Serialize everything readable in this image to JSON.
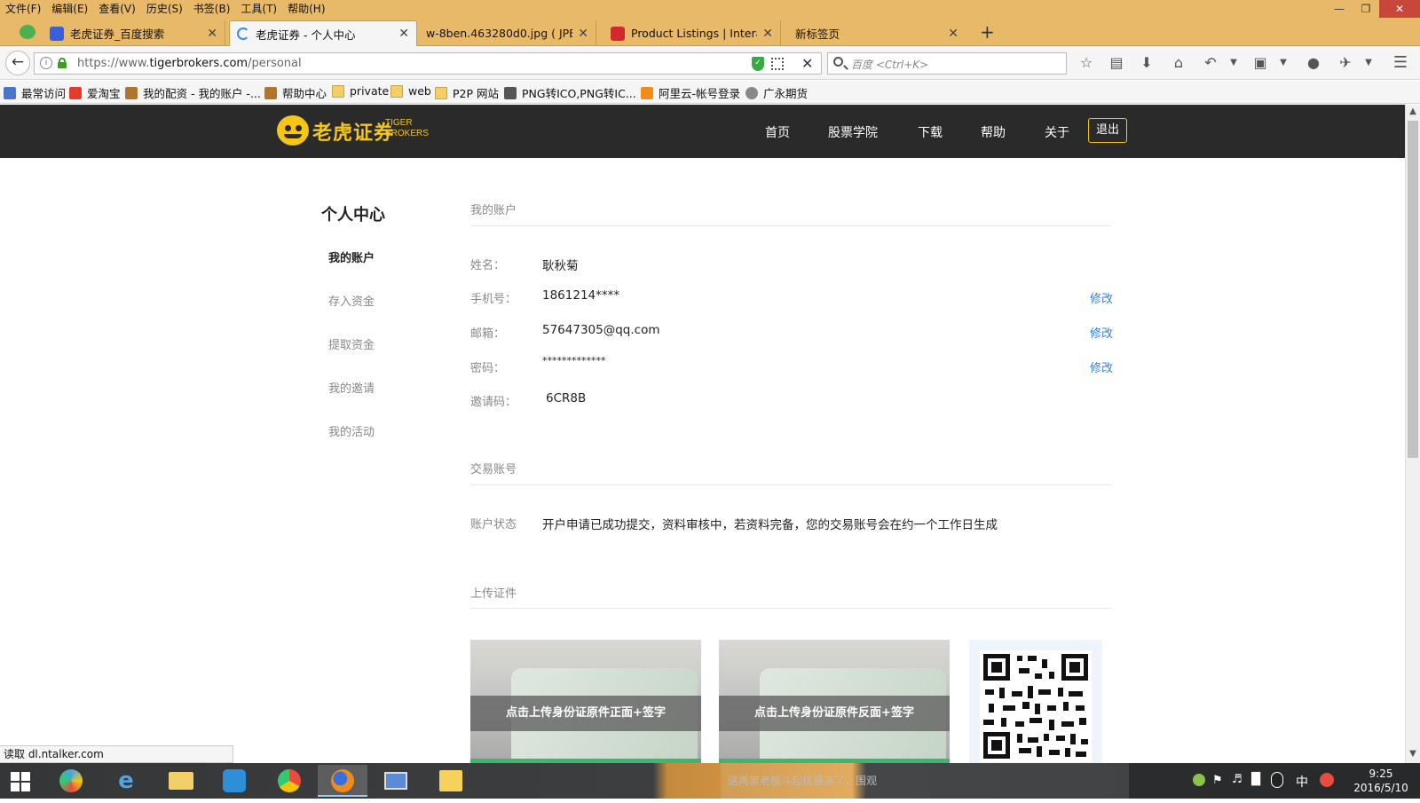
{
  "menubar": {
    "items": [
      "文件(F)",
      "编辑(E)",
      "查看(V)",
      "历史(S)",
      "书签(B)",
      "工具(T)",
      "帮助(H)"
    ]
  },
  "tabs": [
    {
      "title": "老虎证券_百度搜索",
      "icon": "baidu-paw-icon",
      "color": "#3b5fd6"
    },
    {
      "title": "老虎证券 - 个人中心",
      "icon": "loading-spinner-icon",
      "color": "#3a8dde"
    },
    {
      "title": "w-8ben.463280d0.jpg ( JPE…",
      "icon": "image-icon",
      "color": "#e9b96a"
    },
    {
      "title": "Product Listings | Intera…",
      "icon": "ib-logo-icon",
      "color": "#d2282e"
    },
    {
      "title": "新标签页",
      "icon": "blank-page-icon",
      "color": "#e9b96a"
    }
  ],
  "navbar": {
    "url_prefix": "https://www.",
    "url_domain": "tigerbrokers.com",
    "url_path": "/personal",
    "search_placeholder": "百度 <Ctrl+K>"
  },
  "bookmarks": [
    {
      "label": "最常访问",
      "icon": "most-visited-icon"
    },
    {
      "label": "爱淘宝",
      "icon": "taobao-icon"
    },
    {
      "label": "我的配资 - 我的账户 -...",
      "icon": "site-icon"
    },
    {
      "label": "帮助中心",
      "icon": "site-icon"
    },
    {
      "label": "private",
      "icon": "folder-icon"
    },
    {
      "label": "web",
      "icon": "folder-icon"
    },
    {
      "label": "P2P 网站",
      "icon": "folder-icon"
    },
    {
      "label": "PNG转ICO,PNG转IC...",
      "icon": "converter-icon"
    },
    {
      "label": "阿里云-帐号登录",
      "icon": "aliyun-icon"
    },
    {
      "label": "广永期货",
      "icon": "globe-icon"
    }
  ],
  "site": {
    "logo_cn": "老虎证券",
    "logo_en_1": "TIGER",
    "logo_en_2": "BROKERS",
    "nav": [
      "首页",
      "股票学院",
      "下载",
      "帮助",
      "关于"
    ],
    "logout": "退出",
    "brand_color": "#f5c518"
  },
  "sidebar": {
    "title": "个人中心",
    "items": [
      "我的账户",
      "存入资金",
      "提取资金",
      "我的邀请",
      "我的活动"
    ],
    "active_index": 0
  },
  "account": {
    "section_title": "我的账户",
    "fields": [
      {
        "label": "姓名：",
        "value": "耿秋菊",
        "edit": ""
      },
      {
        "label": "手机号：",
        "value": "1861214****",
        "edit": "修改"
      },
      {
        "label": "邮箱：",
        "value": "57647305@qq.com",
        "edit": "修改"
      },
      {
        "label": "密码：",
        "value": "*************",
        "edit": "修改"
      },
      {
        "label": "邀请码：",
        "value": "6CR8B",
        "edit": ""
      }
    ]
  },
  "trading": {
    "section_title": "交易账号",
    "status_label": "账户状态",
    "status_text": "开户申请已成功提交，资料审核中，若资料完备，您的交易账号会在约一个工作日生成"
  },
  "upload": {
    "section_title": "上传证件",
    "front_label": "点击上传身份证原件正面+签字",
    "back_label": "点击上传身份证原件反面+签字"
  },
  "statusbar": {
    "text": "读取 dl.ntalker.com"
  },
  "taskbar": {
    "tray_message": "这两家老板斗起优惠来了，围观",
    "ime": "中",
    "time": "9:25",
    "date": "2016/5/10"
  }
}
